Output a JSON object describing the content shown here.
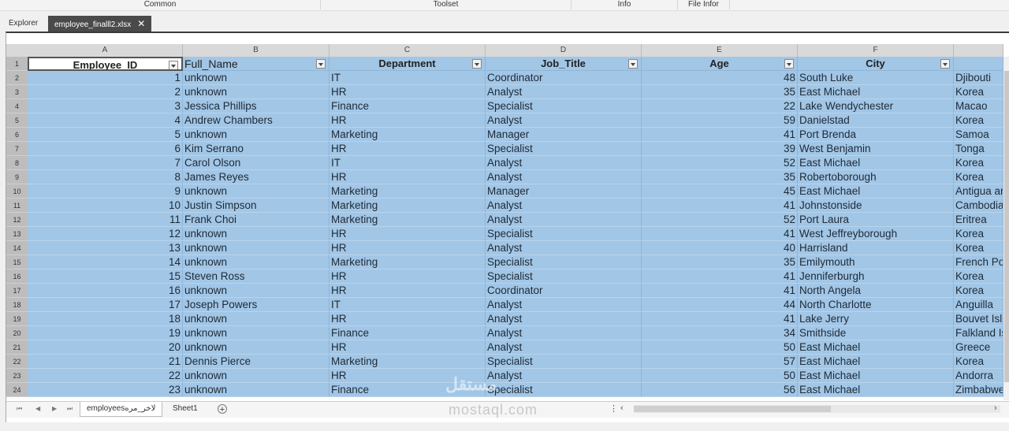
{
  "ribbon": {
    "groups": [
      "Common",
      "Toolset",
      "Info",
      "File Infor"
    ]
  },
  "tabs": {
    "explorer": "Explorer",
    "file": "employee_finalll2.xlsx",
    "close_glyph": "✕"
  },
  "columns": [
    "A",
    "B",
    "C",
    "D",
    "E",
    "F"
  ],
  "header": {
    "employee_id": "Employee_ID",
    "full_name": "Full_Name",
    "department": "Department",
    "job_title": "Job_Title",
    "age": "Age",
    "city": "City"
  },
  "rows": [
    {
      "n": "2",
      "id": "1",
      "name": "unknown",
      "dept": "IT",
      "job": "Coordinator",
      "age": "48",
      "city": "South Luke",
      "country": "Djibouti"
    },
    {
      "n": "3",
      "id": "2",
      "name": "unknown",
      "dept": "HR",
      "job": "Analyst",
      "age": "35",
      "city": "East Michael",
      "country": "Korea"
    },
    {
      "n": "4",
      "id": "3",
      "name": "Jessica Phillips",
      "dept": "Finance",
      "job": "Specialist",
      "age": "22",
      "city": "Lake Wendychester",
      "country": "Macao"
    },
    {
      "n": "5",
      "id": "4",
      "name": "Andrew Chambers",
      "dept": "HR",
      "job": "Analyst",
      "age": "59",
      "city": "Danielstad",
      "country": "Korea"
    },
    {
      "n": "6",
      "id": "5",
      "name": "unknown",
      "dept": "Marketing",
      "job": "Manager",
      "age": "41",
      "city": "Port Brenda",
      "country": "Samoa"
    },
    {
      "n": "7",
      "id": "6",
      "name": "Kim Serrano",
      "dept": "HR",
      "job": "Specialist",
      "age": "39",
      "city": "West Benjamin",
      "country": "Tonga"
    },
    {
      "n": "8",
      "id": "7",
      "name": "Carol Olson",
      "dept": "IT",
      "job": "Analyst",
      "age": "52",
      "city": "East Michael",
      "country": "Korea"
    },
    {
      "n": "9",
      "id": "8",
      "name": "James Reyes",
      "dept": "HR",
      "job": "Analyst",
      "age": "35",
      "city": "Robertoborough",
      "country": "Korea"
    },
    {
      "n": "10",
      "id": "9",
      "name": "unknown",
      "dept": "Marketing",
      "job": "Manager",
      "age": "45",
      "city": "East Michael",
      "country": "Antigua ar"
    },
    {
      "n": "11",
      "id": "10",
      "name": "Justin Simpson",
      "dept": "Marketing",
      "job": "Analyst",
      "age": "41",
      "city": "Johnstonside",
      "country": "Cambodia"
    },
    {
      "n": "12",
      "id": "11",
      "name": "Frank Choi",
      "dept": "Marketing",
      "job": "Analyst",
      "age": "52",
      "city": "Port Laura",
      "country": "Eritrea"
    },
    {
      "n": "13",
      "id": "12",
      "name": "unknown",
      "dept": "HR",
      "job": "Specialist",
      "age": "41",
      "city": "West Jeffreyborough",
      "country": "Korea"
    },
    {
      "n": "14",
      "id": "13",
      "name": "unknown",
      "dept": "HR",
      "job": "Analyst",
      "age": "40",
      "city": "Harrisland",
      "country": "Korea"
    },
    {
      "n": "15",
      "id": "14",
      "name": "unknown",
      "dept": "Marketing",
      "job": "Specialist",
      "age": "35",
      "city": "Emilymouth",
      "country": "French Po"
    },
    {
      "n": "16",
      "id": "15",
      "name": "Steven Ross",
      "dept": "HR",
      "job": "Specialist",
      "age": "41",
      "city": "Jenniferburgh",
      "country": "Korea"
    },
    {
      "n": "17",
      "id": "16",
      "name": "unknown",
      "dept": "HR",
      "job": "Coordinator",
      "age": "41",
      "city": "North Angela",
      "country": "Korea"
    },
    {
      "n": "18",
      "id": "17",
      "name": "Joseph Powers",
      "dept": "IT",
      "job": "Analyst",
      "age": "44",
      "city": "North Charlotte",
      "country": "Anguilla"
    },
    {
      "n": "19",
      "id": "18",
      "name": "unknown",
      "dept": "HR",
      "job": "Analyst",
      "age": "41",
      "city": "Lake Jerry",
      "country": "Bouvet Isl"
    },
    {
      "n": "20",
      "id": "19",
      "name": "unknown",
      "dept": "Finance",
      "job": "Analyst",
      "age": "34",
      "city": "Smithside",
      "country": "Falkland Is"
    },
    {
      "n": "21",
      "id": "20",
      "name": "unknown",
      "dept": "HR",
      "job": "Analyst",
      "age": "50",
      "city": "East Michael",
      "country": "Greece"
    },
    {
      "n": "22",
      "id": "21",
      "name": "Dennis Pierce",
      "dept": "Marketing",
      "job": "Specialist",
      "age": "57",
      "city": "East Michael",
      "country": "Korea"
    },
    {
      "n": "23",
      "id": "22",
      "name": "unknown",
      "dept": "HR",
      "job": "Analyst",
      "age": "50",
      "city": "East Michael",
      "country": "Andorra"
    },
    {
      "n": "24",
      "id": "23",
      "name": "unknown",
      "dept": "Finance",
      "job": "Specialist",
      "age": "56",
      "city": "East Michael",
      "country": "Zimbabwe"
    }
  ],
  "header_row_number": "1",
  "sheets": {
    "active": "employeesلاخر_مره",
    "other": "Sheet1",
    "add": "+"
  },
  "watermark": {
    "arabic": "مستقل",
    "latin": "mostaql.com"
  }
}
